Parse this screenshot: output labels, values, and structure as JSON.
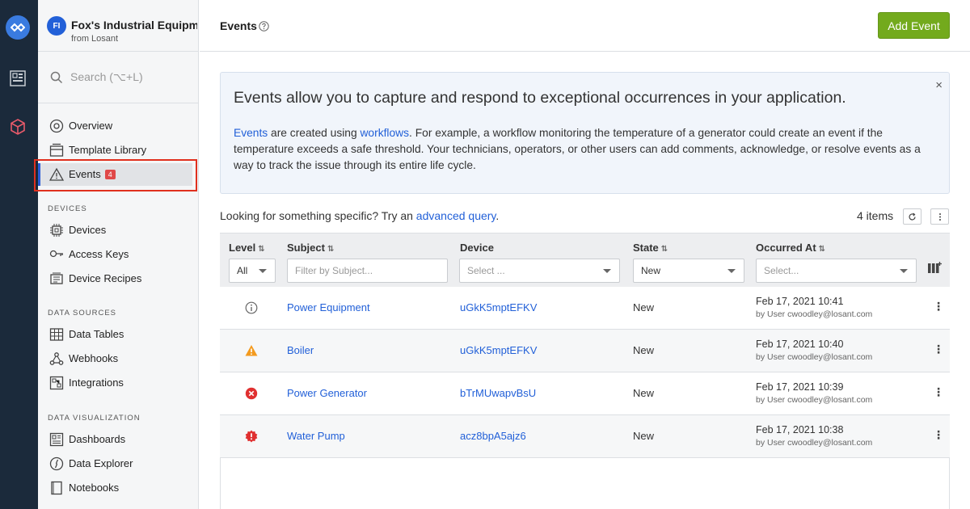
{
  "app": {
    "initials": "FI",
    "name": "Fox's Industrial Equipm...",
    "owner": "from Losant"
  },
  "search": {
    "placeholder": "Search (⌥+L)"
  },
  "nav": {
    "overview": "Overview",
    "template_library": "Template Library",
    "events": "Events",
    "events_badge": "4",
    "devices_section": "DEVICES",
    "devices": "Devices",
    "access_keys": "Access Keys",
    "device_recipes": "Device Recipes",
    "data_sources_section": "DATA SOURCES",
    "data_tables": "Data Tables",
    "webhooks": "Webhooks",
    "integrations": "Integrations",
    "data_vis_section": "DATA VISUALIZATION",
    "dashboards": "Dashboards",
    "data_explorer": "Data Explorer",
    "notebooks": "Notebooks"
  },
  "header": {
    "title": "Events",
    "add_button": "Add Event"
  },
  "banner": {
    "title": "Events allow you to capture and respond to exceptional occurrences in your application.",
    "link_events": "Events",
    "text_1": " are created using ",
    "link_workflows": "workflows",
    "text_2": ". For example, a workflow monitoring the temperature of a generator could create an event if the temperature exceeds a safe threshold. Your technicians, operators, or other users can add comments, acknowledge, or resolve events as a way to track the issue through its entire life cycle.",
    "close": "×"
  },
  "query": {
    "prefix": "Looking for something specific? Try an ",
    "link": "advanced query",
    "suffix": "."
  },
  "items_count": "4 items",
  "table": {
    "columns": {
      "level": "Level",
      "subject": "Subject",
      "device": "Device",
      "state": "State",
      "occurred": "Occurred At"
    },
    "filters": {
      "level": "All",
      "subject_placeholder": "Filter by Subject...",
      "device_placeholder": "Select ...",
      "state": "New",
      "occurred_placeholder": "Select..."
    },
    "rows": [
      {
        "level": "info",
        "subject": "Power Equipment",
        "device": "uGkK5mptEFKV",
        "state": "New",
        "date": "Feb 17, 2021 10:41",
        "by": "by User cwoodley@losant.com"
      },
      {
        "level": "warning",
        "subject": "Boiler",
        "device": "uGkK5mptEFKV",
        "state": "New",
        "date": "Feb 17, 2021 10:40",
        "by": "by User cwoodley@losant.com"
      },
      {
        "level": "error",
        "subject": "Power Generator",
        "device": "bTrMUwapvBsU",
        "state": "New",
        "date": "Feb 17, 2021 10:39",
        "by": "by User cwoodley@losant.com"
      },
      {
        "level": "critical",
        "subject": "Water Pump",
        "device": "acz8bpA5ajz6",
        "state": "New",
        "date": "Feb 17, 2021 10:38",
        "by": "by User cwoodley@losant.com"
      }
    ]
  },
  "colors": {
    "rail": "#1b2a3b",
    "accent": "#2260d8",
    "add_button": "#73aa1d",
    "badge": "#e04848",
    "warning": "#f39a1e",
    "error": "#e03030"
  }
}
